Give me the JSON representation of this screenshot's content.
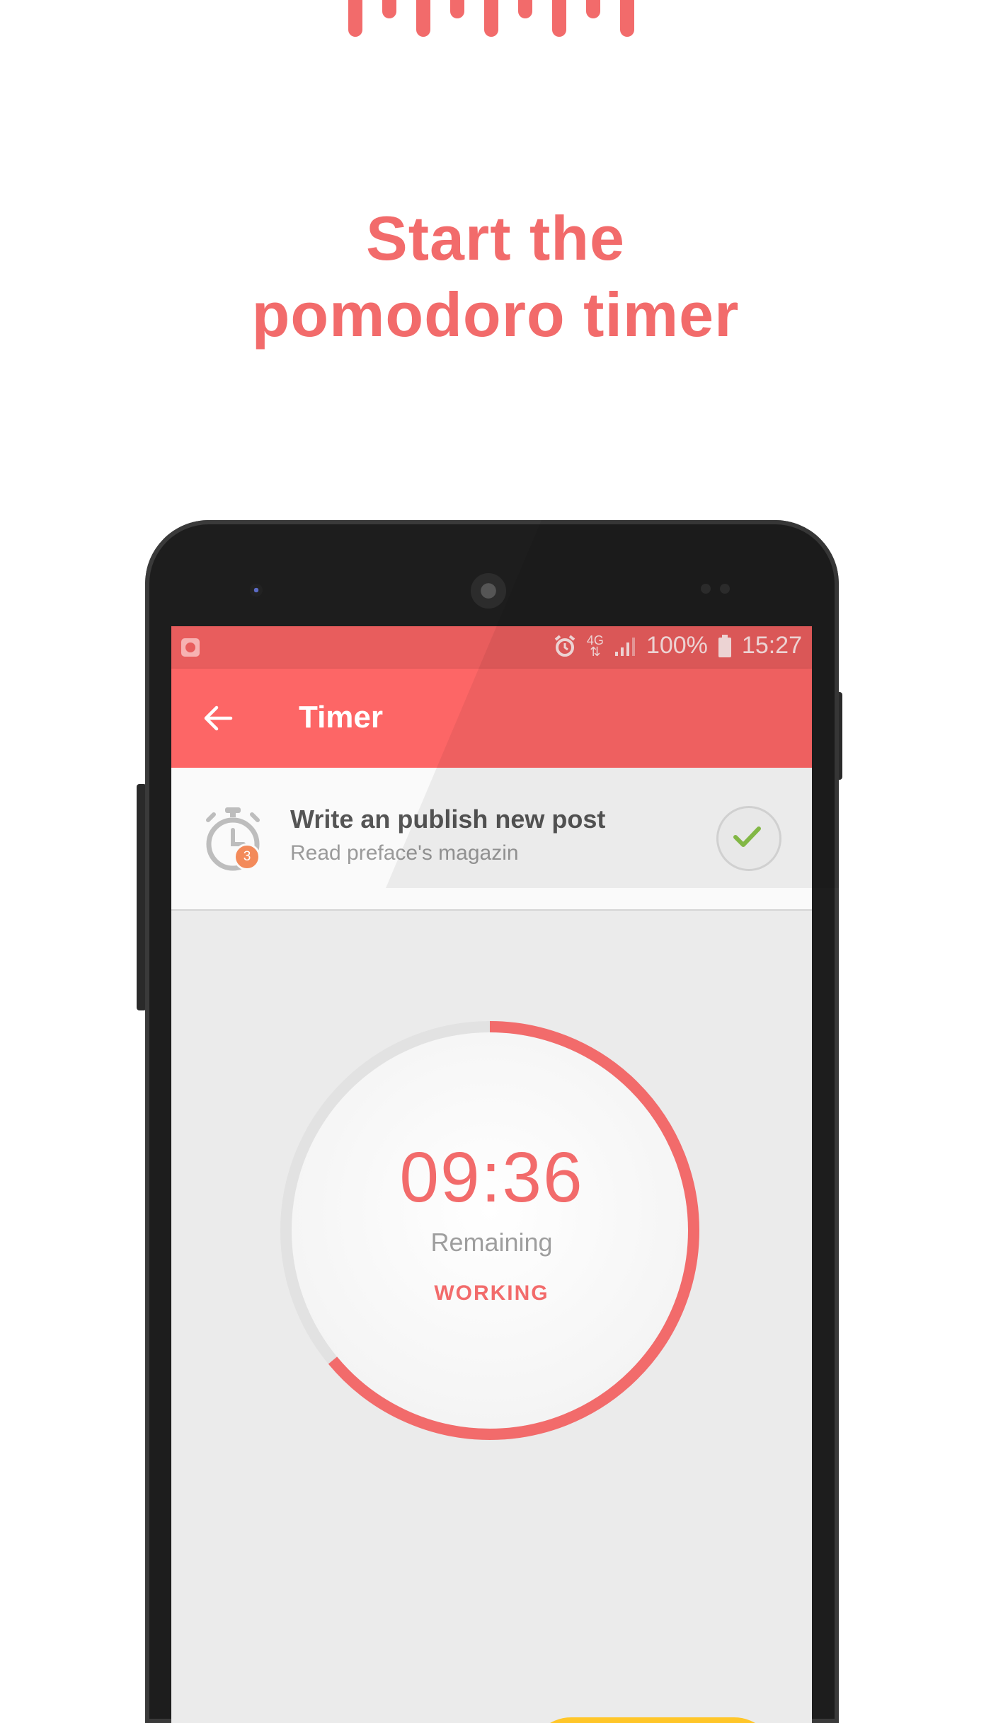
{
  "headline": {
    "line1": "Start the",
    "line2": "pomodoro timer"
  },
  "colors": {
    "accent": "#f26b6b",
    "appbar": "#fd6666",
    "fab": "#ffc629",
    "check": "#8bc34a"
  },
  "status_bar": {
    "battery": "100%",
    "time": "15:27",
    "network": "4G",
    "icons": [
      "app-notification-icon",
      "alarm-icon",
      "network-4g-icon",
      "signal-icon",
      "battery-icon"
    ]
  },
  "appbar": {
    "title": "Timer",
    "back_icon": "arrow-left-icon"
  },
  "task": {
    "title": "Write an publish new post",
    "subtitle": "Read preface's magazin",
    "pomodoro_count": "3",
    "icon": "stopwatch-icon",
    "done_icon": "checkmark-icon"
  },
  "timer": {
    "time": "09:36",
    "label": "Remaining",
    "state": "WORKING",
    "progress_fraction": 0.64
  }
}
